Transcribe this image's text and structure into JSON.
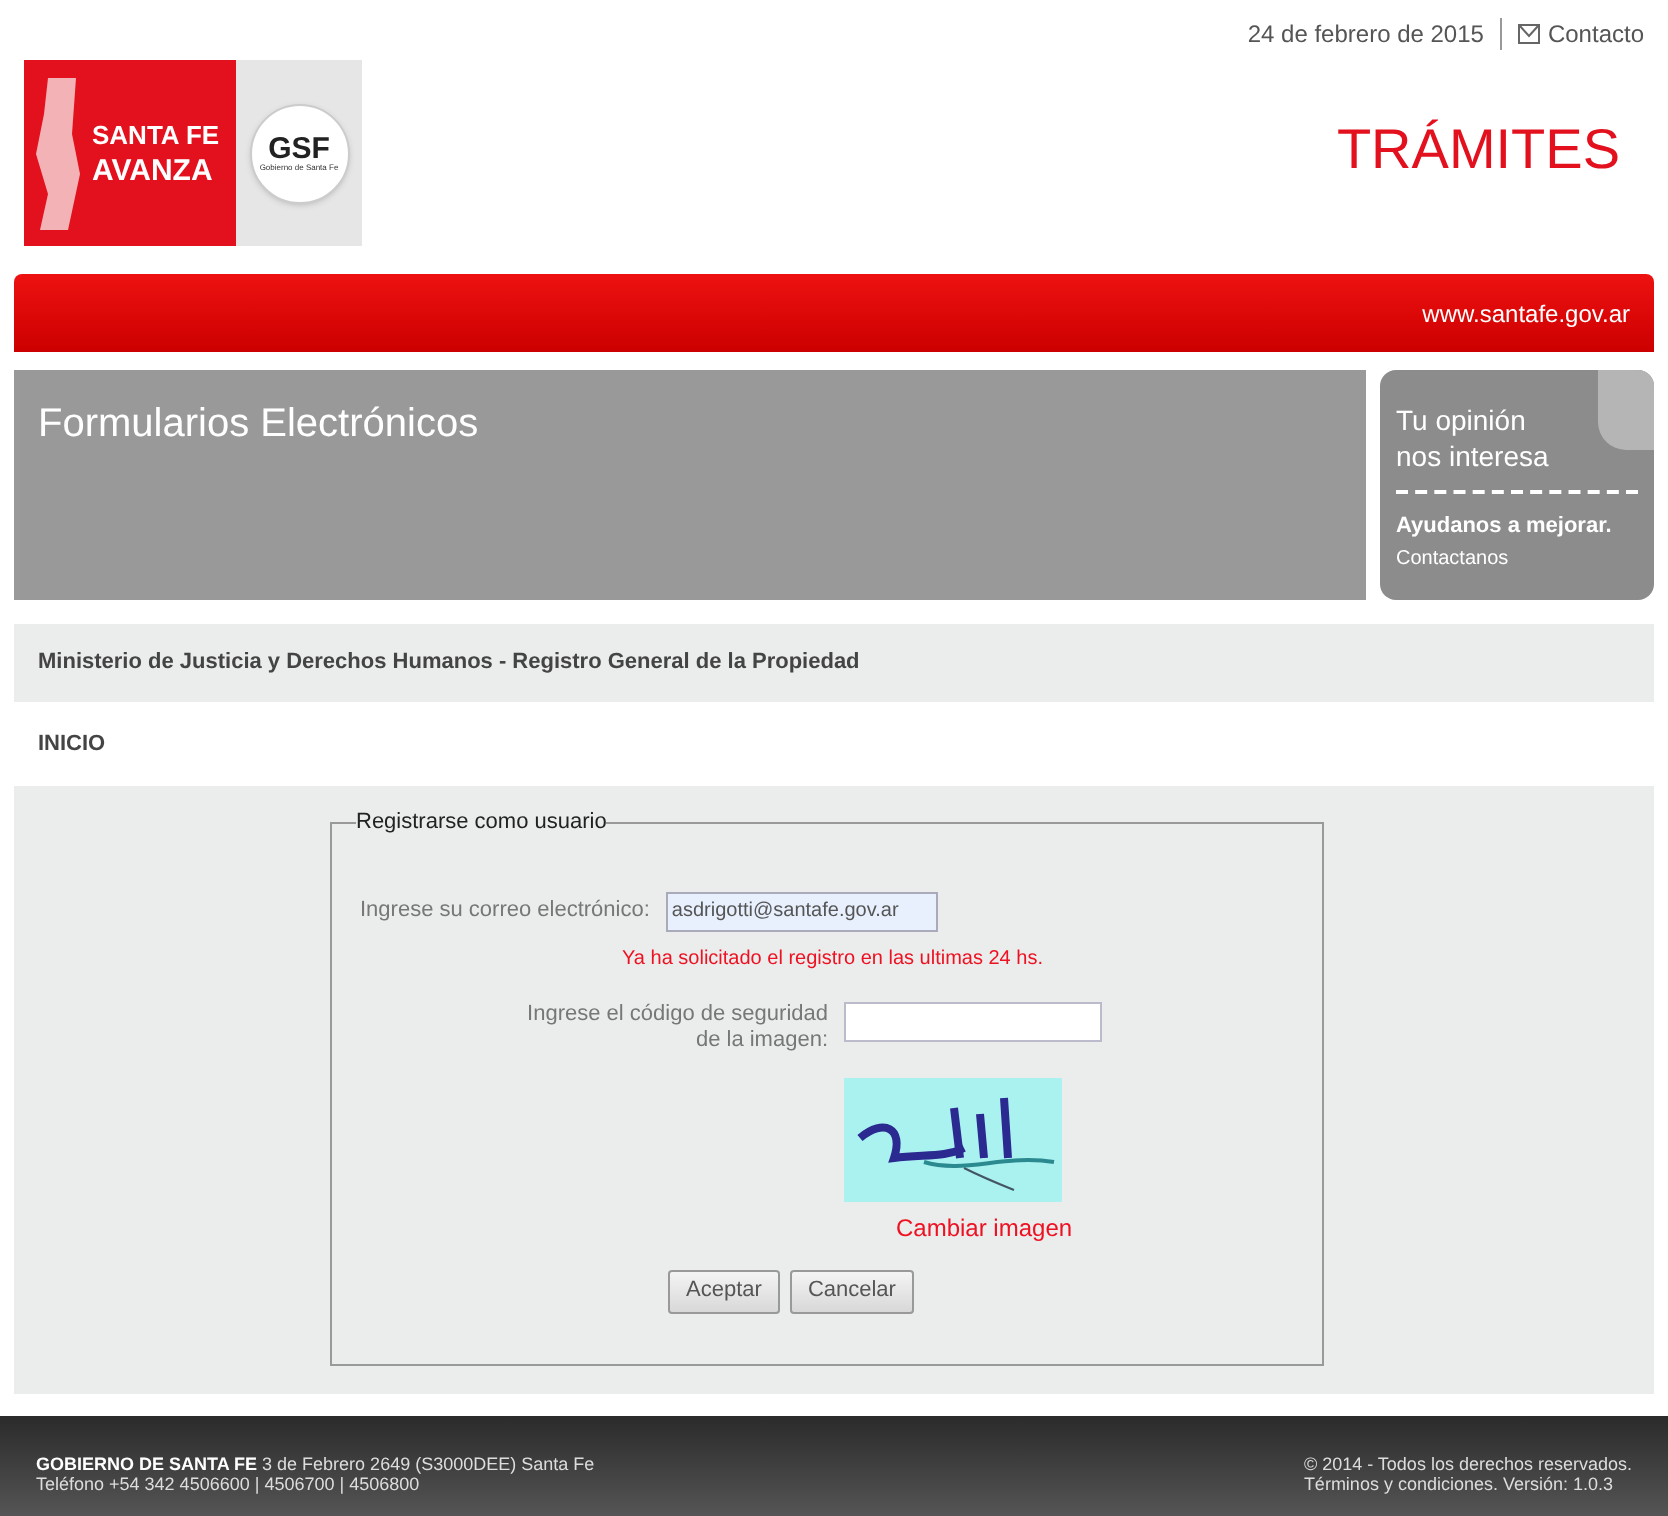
{
  "top_bar": {
    "date": "24 de febrero de 2015",
    "contact": "Contacto"
  },
  "logo": {
    "line1": "SANTA FE",
    "line2": "AVANZA",
    "badge": "GSF",
    "badge_caption": "Gobierno de Santa Fe"
  },
  "section_title": "TRÁMITES",
  "red_bar": {
    "url": "www.santafe.gov.ar"
  },
  "banner": {
    "title": "Formularios Electrónicos"
  },
  "opinion_card": {
    "line1": "Tu opinión",
    "line2": "nos interesa",
    "cta": "Ayudanos a mejorar.",
    "link": "Contactanos"
  },
  "breadcrumb": "Ministerio de Justicia y Derechos Humanos - Registro General de la Propiedad",
  "page_heading": "INICIO",
  "form": {
    "legend": "Registrarse como usuario",
    "email_label": "Ingrese su correo electrónico:",
    "email_value": "asdrigotti@santafe.gov.ar",
    "error": "Ya ha solicitado el registro en las ultimas 24 hs.",
    "code_label_line1": "Ingrese el código de seguridad",
    "code_label_line2": "de la imagen:",
    "change_image": "Cambiar imagen",
    "buttons": [
      "Aceptar",
      "Cancelar"
    ]
  },
  "footer": {
    "org": "GOBIERNO DE SANTA FE",
    "address": "3 de Febrero 2649 (S3000DEE) Santa Fe",
    "phone": "Teléfono +54 342 4506600 | 4506700 | 4506800",
    "copyright": "© 2014 - Todos los derechos reservados.",
    "terms": "Términos y condiciones. Versión: 1.0.3"
  }
}
